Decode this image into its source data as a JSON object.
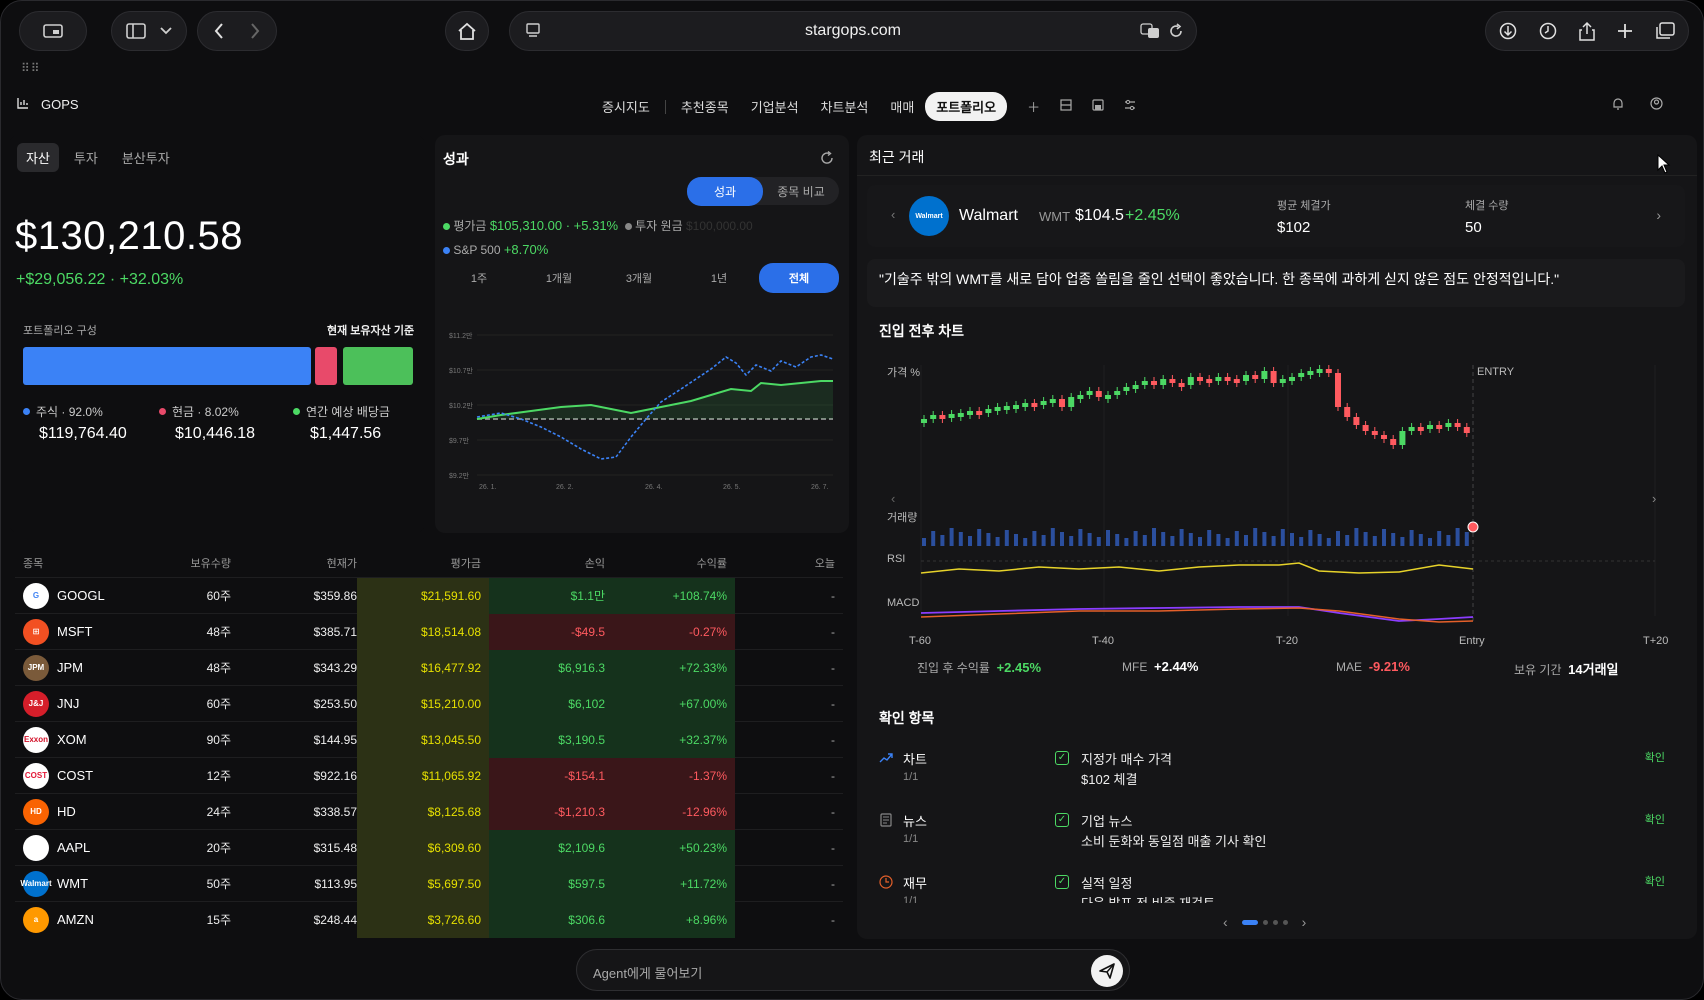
{
  "browser": {
    "url": "stargops.com"
  },
  "app": {
    "brand": "GOPS",
    "menu": [
      "증시지도",
      "추천종목",
      "기업분석",
      "차트분석",
      "매매",
      "포트폴리오"
    ],
    "active_menu": "포트폴리오"
  },
  "assets": {
    "tabs": [
      "자산",
      "투자",
      "분산투자"
    ],
    "total": "$130,210.58",
    "gain": "+$29,056.22 · +32.03%",
    "composition_label": "포트폴리오 구성",
    "composition_basis": "현재 보유자산 기준",
    "legend": [
      {
        "label": "주식 · 92.0%",
        "value": "$119,764.40",
        "color": "#3b82f6"
      },
      {
        "label": "현금 · 8.02%",
        "value": "$10,446.18",
        "color": "#e84a6a"
      },
      {
        "label": "연간 예상 배당금",
        "value": "$1,447.56",
        "color": "#4cd964"
      }
    ]
  },
  "performance": {
    "title": "성과",
    "segments": [
      "성과",
      "종목 비교"
    ],
    "legend": {
      "avg_label": "평가금",
      "avg_value": "$105,310.00 · +5.31%",
      "principal_label": "투자 원금",
      "principal_value": "$100,000.00",
      "sp_label": "S&P 500",
      "sp_value": "+8.70%"
    },
    "ranges": [
      "1주",
      "1개월",
      "3개월",
      "1년",
      "전체"
    ],
    "active_range": "전체"
  },
  "perf_chart": {
    "y_ticks": [
      "$11.2만",
      "$10.7만",
      "$10.2만",
      "$9.7만",
      "$9.2만"
    ],
    "x_ticks": [
      "26. 1.",
      "26. 2.",
      "26. 4.",
      "26. 5.",
      "26. 7."
    ]
  },
  "holdings": {
    "headers": [
      "종목",
      "보유수량",
      "현재가",
      "평가금",
      "손익",
      "수익률",
      "오늘"
    ],
    "rows": [
      {
        "name": "GOOGL",
        "qty": "60주",
        "price": "$359.86",
        "value": "$21,591.60",
        "pl": "$1.1만",
        "ret": "+108.74%",
        "today": "-",
        "dir": "pos",
        "logo": "G",
        "logo_bg": "#ffffff",
        "logo_fg": "#4285f4"
      },
      {
        "name": "MSFT",
        "qty": "48주",
        "price": "$385.71",
        "value": "$18,514.08",
        "pl": "-$49.5",
        "ret": "-0.27%",
        "today": "-",
        "dir": "neg",
        "logo": "⊞",
        "logo_bg": "#f25022",
        "logo_fg": "#fff"
      },
      {
        "name": "JPM",
        "qty": "48주",
        "price": "$343.29",
        "value": "$16,477.92",
        "pl": "$6,916.3",
        "ret": "+72.33%",
        "today": "-",
        "dir": "pos",
        "logo": "JPM",
        "logo_bg": "#7a5a3a",
        "logo_fg": "#fff"
      },
      {
        "name": "JNJ",
        "qty": "60주",
        "price": "$253.50",
        "value": "$15,210.00",
        "pl": "$6,102",
        "ret": "+67.00%",
        "today": "-",
        "dir": "pos",
        "logo": "J&J",
        "logo_bg": "#d51e2a",
        "logo_fg": "#fff"
      },
      {
        "name": "XOM",
        "qty": "90주",
        "price": "$144.95",
        "value": "$13,045.50",
        "pl": "$3,190.5",
        "ret": "+32.37%",
        "today": "-",
        "dir": "pos",
        "logo": "Exxon",
        "logo_bg": "#ffffff",
        "logo_fg": "#d3122a"
      },
      {
        "name": "COST",
        "qty": "12주",
        "price": "$922.16",
        "value": "$11,065.92",
        "pl": "-$154.1",
        "ret": "-1.37%",
        "today": "-",
        "dir": "neg",
        "logo": "COST",
        "logo_bg": "#ffffff",
        "logo_fg": "#e31837"
      },
      {
        "name": "HD",
        "qty": "24주",
        "price": "$338.57",
        "value": "$8,125.68",
        "pl": "-$1,210.3",
        "ret": "-12.96%",
        "today": "-",
        "dir": "neg",
        "logo": "HD",
        "logo_bg": "#f96302",
        "logo_fg": "#fff"
      },
      {
        "name": "AAPL",
        "qty": "20주",
        "price": "$315.48",
        "value": "$6,309.60",
        "pl": "$2,109.6",
        "ret": "+50.23%",
        "today": "-",
        "dir": "pos",
        "logo": "",
        "logo_bg": "#ffffff",
        "logo_fg": "#000"
      },
      {
        "name": "WMT",
        "qty": "50주",
        "price": "$113.95",
        "value": "$5,697.50",
        "pl": "$597.5",
        "ret": "+11.72%",
        "today": "-",
        "dir": "pos",
        "logo": "Walmart",
        "logo_bg": "#0071ce",
        "logo_fg": "#fff"
      },
      {
        "name": "AMZN",
        "qty": "15주",
        "price": "$248.44",
        "value": "$3,726.60",
        "pl": "$306.6",
        "ret": "+8.96%",
        "today": "-",
        "dir": "pos",
        "logo": "a",
        "logo_bg": "#ff9900",
        "logo_fg": "#fff"
      }
    ]
  },
  "recent": {
    "title": "최근 거래",
    "trade": {
      "name": "Walmart",
      "ticker": "WMT",
      "price": "$104.5",
      "change": "+2.45%",
      "avg_label": "평균 체결가",
      "avg_value": "$102",
      "qty_label": "체결 수량",
      "qty_value": "50",
      "logo": "Walmart"
    },
    "quote": "\"기술주 밖의 WMT를 새로 담아 업종 쏠림을 줄인 선택이 좋았습니다. 한 종목에 과하게 싣지 않은 점도 안정적입니다.\"",
    "chart_title": "진입 전후 차트",
    "chart_labels": {
      "price": "가격 %",
      "entry": "ENTRY",
      "volume": "거래량",
      "rsi": "RSI",
      "macd": "MACD",
      "x_ticks": [
        "T-60",
        "T-40",
        "T-20",
        "Entry",
        "T+20"
      ]
    },
    "stats": [
      {
        "label": "진입 후 수익률",
        "value": "+2.45%",
        "color": "#4cd964"
      },
      {
        "label": "MFE",
        "value": "+2.44%",
        "color": "#ffffff"
      },
      {
        "label": "MAE",
        "value": "-9.21%",
        "color": "#ff5a5f"
      },
      {
        "label": "보유 기간",
        "value": "14거래일",
        "color": "#ffffff"
      }
    ],
    "checks_title": "확인 항목",
    "checks": [
      {
        "cat": "차트",
        "count": "1/1",
        "icon": "trend-icon",
        "title": "지정가 매수 가격",
        "detail": "$102 체결",
        "status": "확인"
      },
      {
        "cat": "뉴스",
        "count": "1/1",
        "icon": "news-icon",
        "title": "기업 뉴스",
        "detail": "소비 둔화와 동일점 매출 기사 확인",
        "status": "확인"
      },
      {
        "cat": "재무",
        "count": "1/1",
        "icon": "clock-icon",
        "title": "실적 일정",
        "detail": "다음 발표 전 비중 재검토",
        "status": "확인"
      }
    ]
  },
  "agent": {
    "placeholder": "Agent에게 물어보기"
  },
  "colors": {
    "accent": "#2b6fe8",
    "up": "#4cd964",
    "down": "#ff5a5f"
  }
}
